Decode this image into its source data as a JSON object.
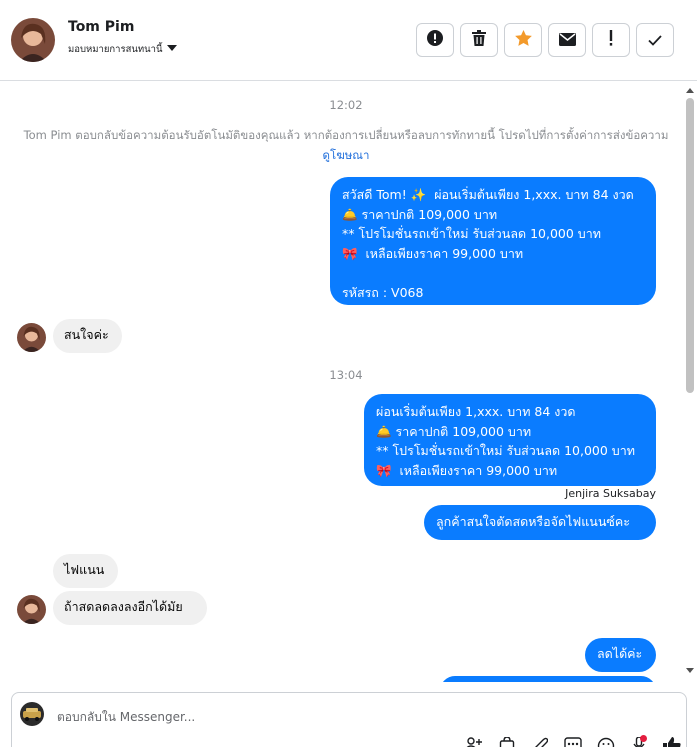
{
  "header": {
    "name": "Tom Pim",
    "assign_label": "มอบหมายการสนทนานี้",
    "toolbar": [
      "alert-icon",
      "trash-icon",
      "star-icon",
      "envelope-icon",
      "exclamation-icon",
      "check-icon"
    ]
  },
  "accent_color": "#0a7cff",
  "star_color": "#f39a2b",
  "chat": {
    "time1": "12:02",
    "system_message": "Tom Pim ตอบกลับข้อความต้อนรับอัตโนมัติของคุณแล้ว หากต้องการเปลี่ยนหรือลบการทักทายนี้ โปรดไปที่การตั้งค่าการส่งข้อความ",
    "system_link": "ดูโฆษณา",
    "msg1": "สวัสดี Tom! ✨  ผ่อนเริ่มต้นเพียง 1,xxx. บาท 84 งวด\n🛎️ ราคาปกติ 109,000 บาท\n** โปรโมชั่นรถเข้าใหม่ รับส่วนลด 10,000 บาท\n🎀  เหลือเพียงราคา 99,000 บาท\n\nรหัสรถ : V068",
    "msg2": "สนใจค่ะ",
    "time2": "13:04",
    "msg3": "ผ่อนเริ่มต้นเพียง 1,xxx. บาท 84 งวด\n🛎️ ราคาปกติ 109,000 บาท\n** โปรโมชั่นรถเข้าใหม่ รับส่วนลด 10,000 บาท\n🎀  เหลือเพียงราคา 99,000 บาท",
    "sender": "Jenjira Suksabay",
    "msg4": "ลูกค้าสนใจตัดสดหรือจัดไฟแนนซ์คะ",
    "msg5": "ไฟแนน",
    "msg6": "ถ้าสดลดลงลงอีกได้มัย",
    "msg7": "ลดได้ค่ะ"
  },
  "composer": {
    "placeholder": "ตอบกลับใน Messenger...",
    "tools": [
      "add-person-icon",
      "bag-icon",
      "attachment-icon",
      "more-icon",
      "emoji-icon",
      "mic-icon",
      "thumbs-up-icon"
    ]
  }
}
